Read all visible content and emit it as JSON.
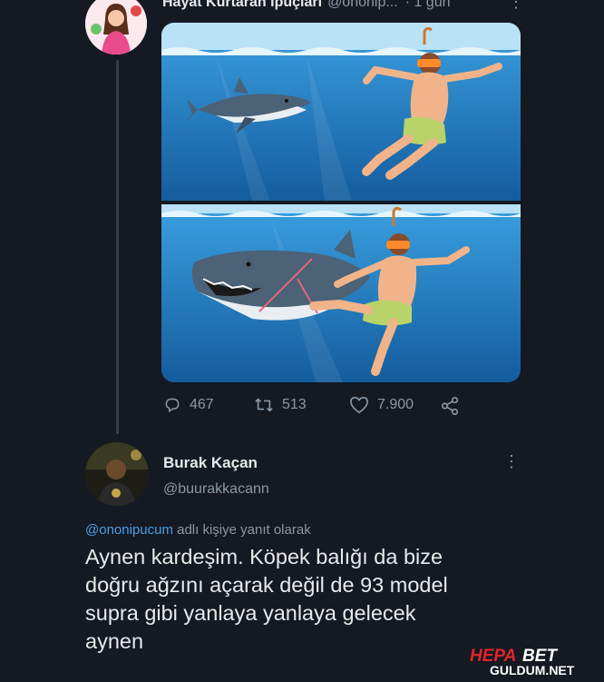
{
  "tweet": {
    "author_name": "Hayat Kurtaran İpuçları",
    "handle": "@ononip...",
    "date": "· 1 gün",
    "more_icon": "more-vertical-icon",
    "stats": {
      "replies": "467",
      "retweets": "513",
      "likes": "7.900"
    }
  },
  "reply": {
    "author_name": "Burak Kaçan",
    "handle": "@buurakkacann",
    "mention": "@ononipucum",
    "reply_suffix": "adlı kişiye yanıt olarak",
    "lines": [
      "Aynen kardeşim. Köpek balığı da bize",
      "doğru ağzını açarak değil de 93 model",
      "supra gibi yanlaya yanlaya gelecek",
      "aynen"
    ]
  },
  "watermark": {
    "top": "HEPAB",
    "bottom": "GULDUM.NET"
  },
  "colors": {
    "background": "#151922",
    "text": "#e7e9ea",
    "muted": "#8b98a5",
    "link": "#4a9fe8",
    "water": "#1f7fc2",
    "watermark_red": "#e0262b"
  }
}
